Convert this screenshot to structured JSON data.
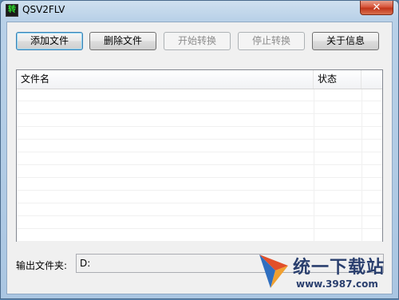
{
  "window": {
    "title": "QSV2FLV",
    "icon_glyph": "转",
    "close_glyph": "✕"
  },
  "toolbar": {
    "add_label": "添加文件",
    "delete_label": "删除文件",
    "start_label": "开始转换",
    "stop_label": "停止转换",
    "about_label": "关于信息"
  },
  "file_list": {
    "columns": [
      "文件名",
      "状态"
    ],
    "rows": []
  },
  "output": {
    "label": "输出文件夹:",
    "value": "D:"
  },
  "watermark": {
    "title": "统一下载站",
    "url": "www.3987.com"
  },
  "colors": {
    "close_button": "#c1351a",
    "title_bar": "#b9d1e8",
    "watermark": "#2a3f6e"
  }
}
